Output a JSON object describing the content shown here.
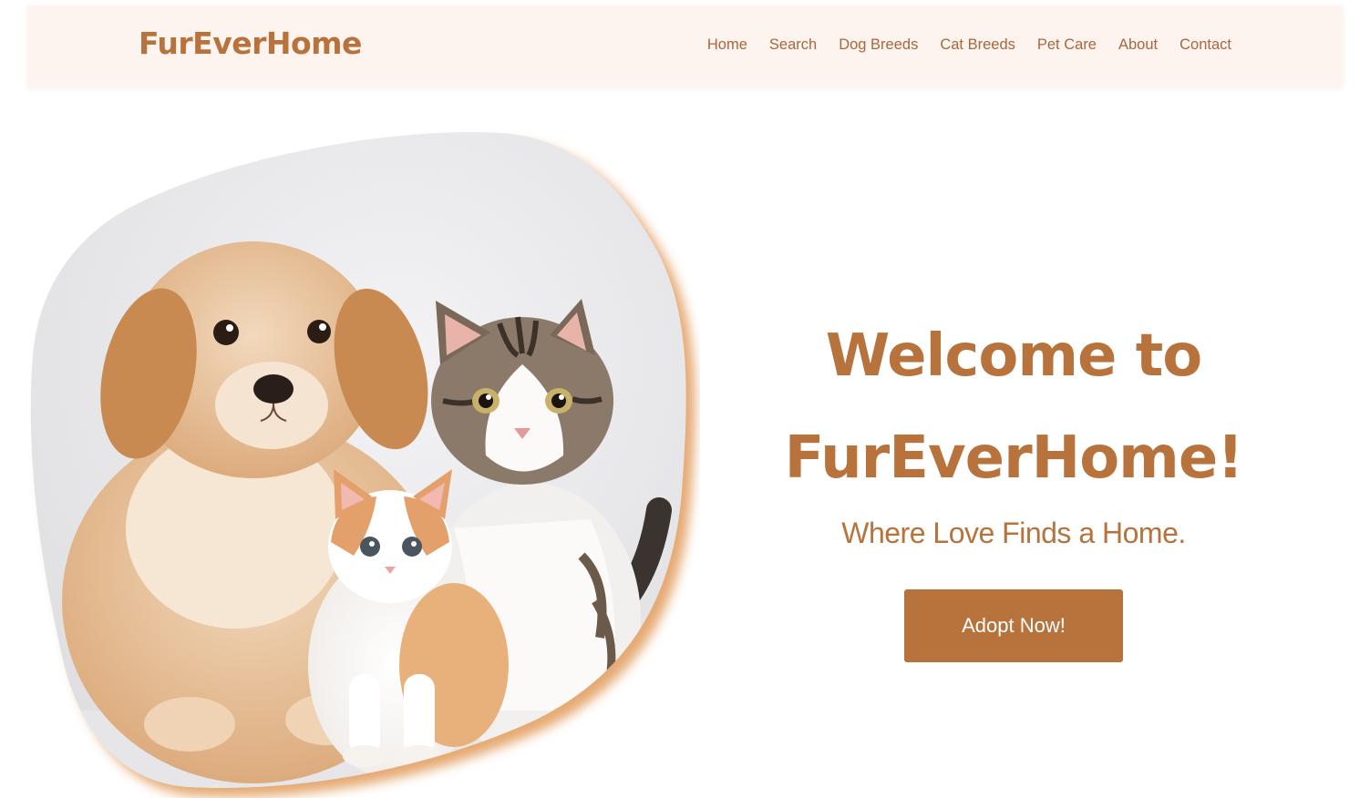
{
  "brand": {
    "name": "FurEverHome"
  },
  "nav": {
    "items": [
      {
        "label": "Home"
      },
      {
        "label": "Search"
      },
      {
        "label": "Dog Breeds"
      },
      {
        "label": "Cat Breeds"
      },
      {
        "label": "Pet Care"
      },
      {
        "label": "About"
      },
      {
        "label": "Contact"
      }
    ]
  },
  "hero": {
    "headline_line1": "Welcome to",
    "headline_line2": "FurEverHome!",
    "tagline": "Where Love Finds a Home.",
    "cta_label": "Adopt Now!",
    "image_subject": "golden puppy with two kittens"
  },
  "colors": {
    "accent": "#b8733c",
    "nav_background": "#fdf3ef",
    "button_text": "#ffffff"
  }
}
